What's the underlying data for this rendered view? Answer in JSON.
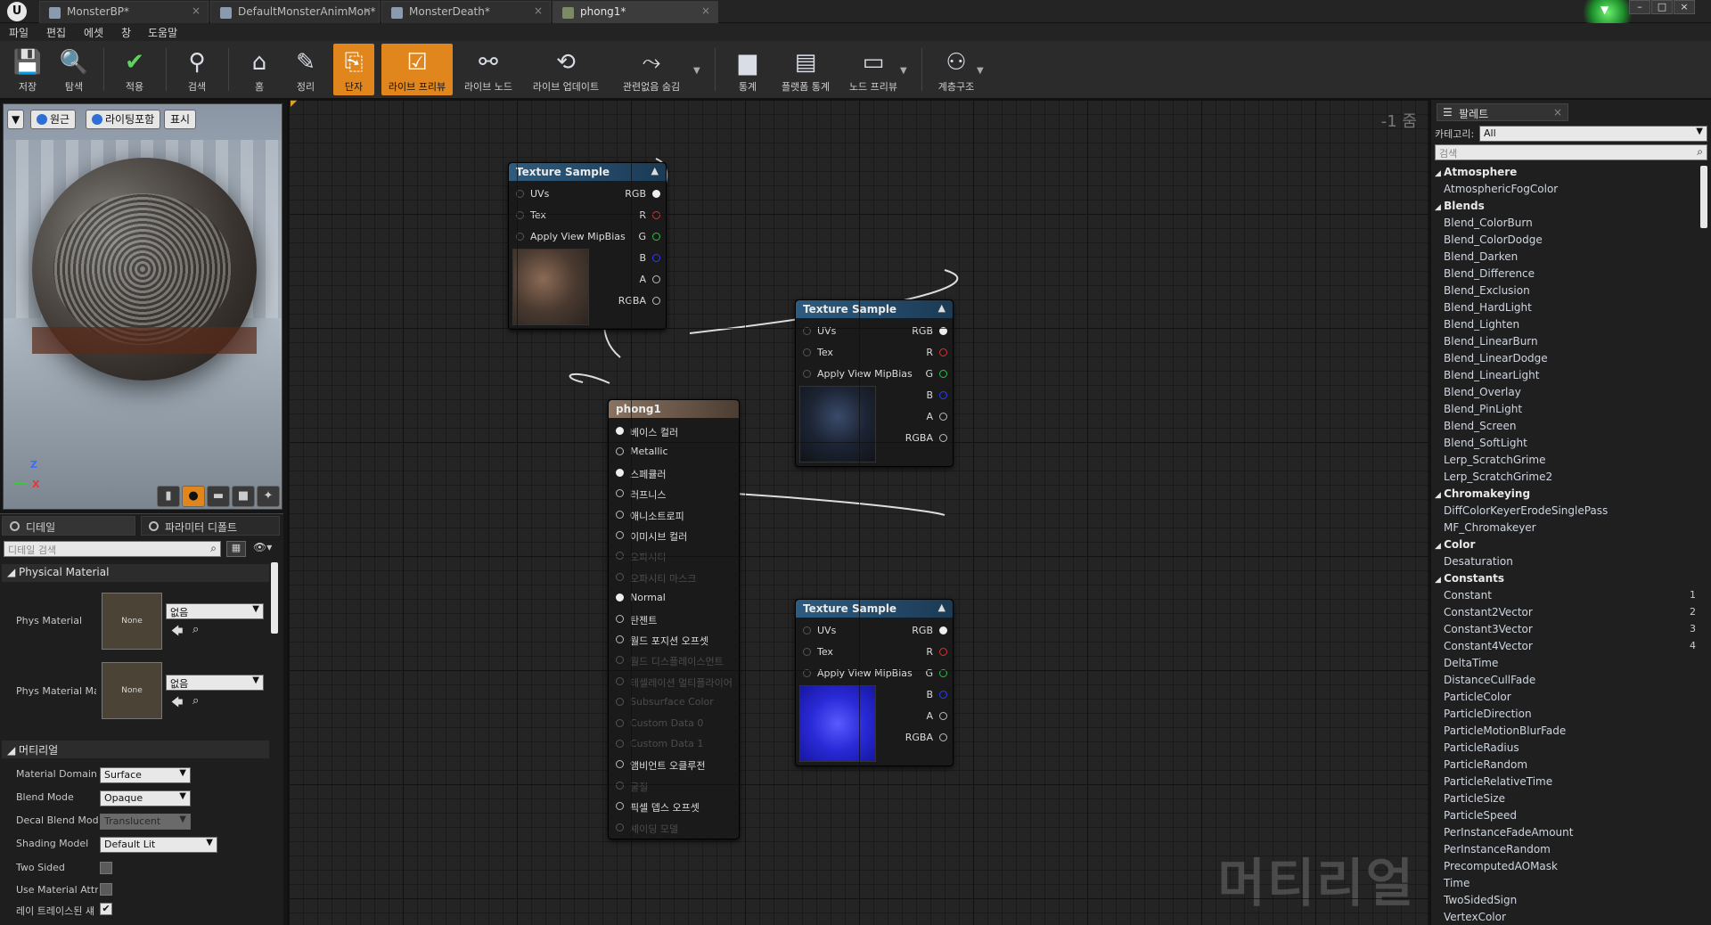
{
  "tabs": [
    "MonsterBP*",
    "DefaultMonsterAnimMon*",
    "MonsterDeath*",
    "phong1*"
  ],
  "menu": [
    "파일",
    "편집",
    "에셋",
    "창",
    "도움말"
  ],
  "toolbar": [
    "저장",
    "탐색",
    "적용",
    "검색",
    "홈",
    "정리",
    "단자",
    "라이브 프리뷰",
    "라이브 노드",
    "라이브 업데이트",
    "관련없음 숨김",
    "통계",
    "플랫폼 통계",
    "노드 프리뷰",
    "계층구조"
  ],
  "viewport": {
    "buttons": [
      "원근",
      "라이팅포함",
      "표시"
    ],
    "axis_z": "Z",
    "axis_x": "X"
  },
  "details": {
    "tabs": [
      "디테일",
      "파라미터 디폴트"
    ],
    "search_placeholder": "디테일 검색",
    "section_physical": "Physical Material",
    "phys_material_label": "Phys Material",
    "phys_material_mask_label": "Phys Material Ma",
    "none_thumb": "None",
    "none_dd": "없음",
    "section_material": "머티리얼",
    "rows": [
      {
        "label": "Material Domain",
        "value": "Surface"
      },
      {
        "label": "Blend Mode",
        "value": "Opaque"
      },
      {
        "label": "Decal Blend Mode",
        "value": "Translucent"
      },
      {
        "label": "Shading Model",
        "value": "Default Lit"
      }
    ],
    "checks": [
      {
        "label": "Two Sided",
        "checked": false
      },
      {
        "label": "Use Material Attri",
        "checked": false
      },
      {
        "label": "레이 트레이스된 섀",
        "checked": true
      }
    ]
  },
  "graph": {
    "zoom": "-1 줌",
    "watermark": "머티리얼",
    "texture_sample_title": "Texture Sample",
    "inputs": [
      "UVs",
      "Tex",
      "Apply View MipBias"
    ],
    "outputs": [
      "RGB",
      "R",
      "G",
      "B",
      "A",
      "RGBA"
    ],
    "phong": {
      "title": "phong1",
      "pins": [
        {
          "label": "베이스 컬러",
          "active": true
        },
        {
          "label": "Metallic",
          "active": true
        },
        {
          "label": "스페큘러",
          "active": true
        },
        {
          "label": "러프니스",
          "active": true
        },
        {
          "label": "애니소트로피",
          "active": true
        },
        {
          "label": "이미시브 컬러",
          "active": true
        },
        {
          "label": "오파시티",
          "active": false
        },
        {
          "label": "오파시티 마스크",
          "active": false
        },
        {
          "label": "Normal",
          "active": true
        },
        {
          "label": "탄젠트",
          "active": true
        },
        {
          "label": "월드 포지션 오프셋",
          "active": true
        },
        {
          "label": "월드 디스플레이스먼트",
          "active": false
        },
        {
          "label": "테셀레이션 멀티플라이어",
          "active": false
        },
        {
          "label": "Subsurface Color",
          "active": false
        },
        {
          "label": "Custom Data 0",
          "active": false
        },
        {
          "label": "Custom Data 1",
          "active": false
        },
        {
          "label": "앰비언트 오클루전",
          "active": true
        },
        {
          "label": "굴절",
          "active": false
        },
        {
          "label": "픽셀 뎁스 오프셋",
          "active": true
        },
        {
          "label": "셰이딩 모델",
          "active": false
        }
      ]
    }
  },
  "palette": {
    "title": "팔레트",
    "category_label": "카테고리:",
    "category_value": "All",
    "search_placeholder": "검색",
    "groups": [
      {
        "name": "Atmosphere",
        "items": [
          "AtmosphericFogColor"
        ]
      },
      {
        "name": "Blends",
        "items": [
          "Blend_ColorBurn",
          "Blend_ColorDodge",
          "Blend_Darken",
          "Blend_Difference",
          "Blend_Exclusion",
          "Blend_HardLight",
          "Blend_Lighten",
          "Blend_LinearBurn",
          "Blend_LinearDodge",
          "Blend_LinearLight",
          "Blend_Overlay",
          "Blend_PinLight",
          "Blend_Screen",
          "Blend_SoftLight",
          "Lerp_ScratchGrime",
          "Lerp_ScratchGrime2"
        ]
      },
      {
        "name": "Chromakeying",
        "items": [
          "DiffColorKeyerErodeSinglePass",
          "MF_Chromakeyer"
        ]
      },
      {
        "name": "Color",
        "items": [
          "Desaturation"
        ]
      },
      {
        "name": "Constants",
        "items": [
          "Constant",
          "Constant2Vector",
          "Constant3Vector",
          "Constant4Vector",
          "DeltaTime",
          "DistanceCullFade",
          "ParticleColor",
          "ParticleDirection",
          "ParticleMotionBlurFade",
          "ParticleRadius",
          "ParticleRandom",
          "ParticleRelativeTime",
          "ParticleSize",
          "ParticleSpeed",
          "PerInstanceFadeAmount",
          "PerInstanceRandom",
          "PrecomputedAOMask",
          "Time",
          "TwoSidedSign",
          "VertexColor"
        ]
      }
    ],
    "hotkeys": [
      "1",
      "2",
      "3",
      "4"
    ]
  },
  "colors": {
    "accent": "#e0861d",
    "node_header": "#2d5c80",
    "r": "#e03030",
    "g": "#30c040",
    "b": "#2a3cff"
  }
}
